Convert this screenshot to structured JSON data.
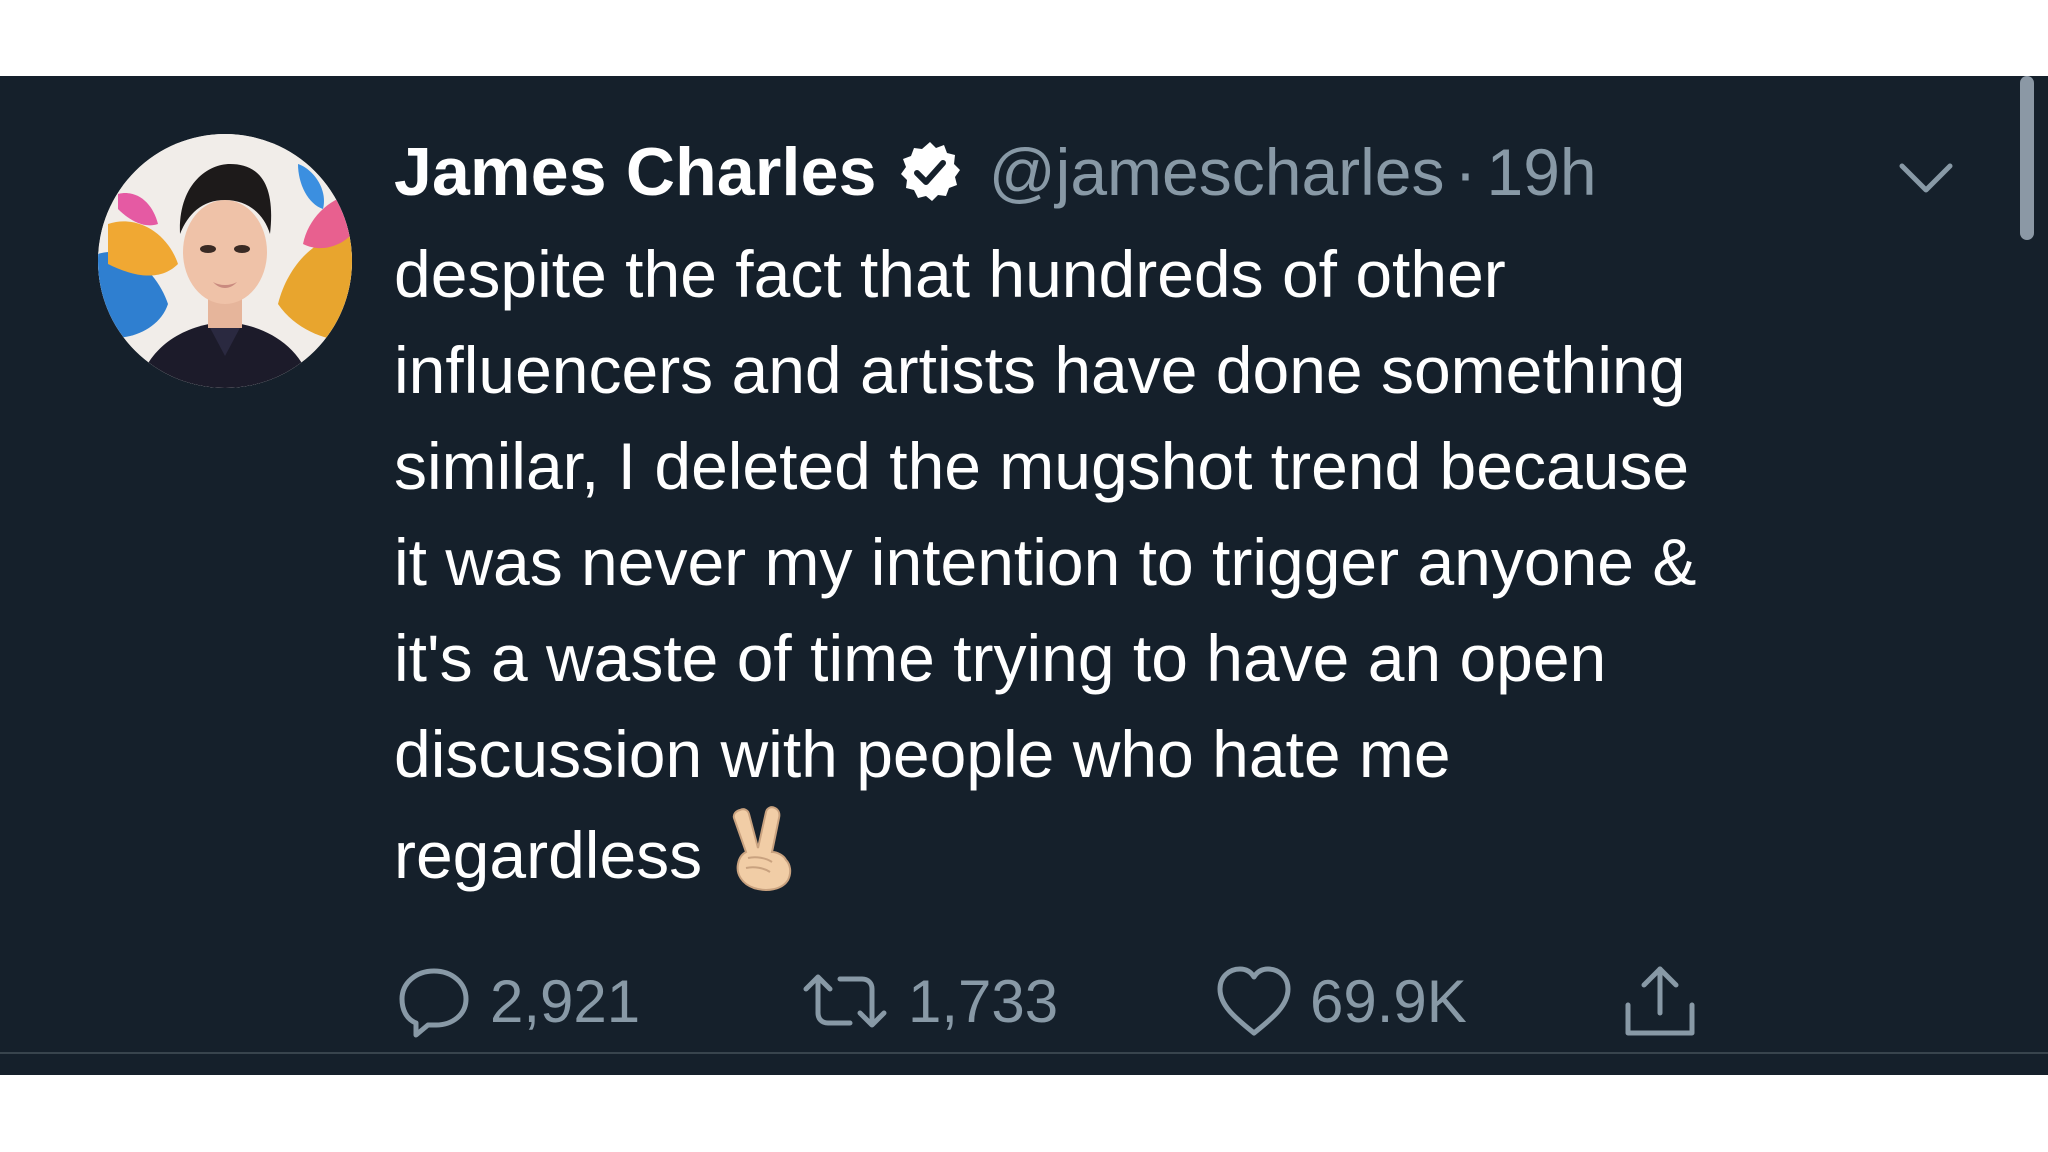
{
  "tweet": {
    "author": {
      "display_name": "James Charles",
      "handle": "@jamescharles",
      "verified": true
    },
    "separator": "·",
    "timestamp": "19h",
    "text_lines": [
      "despite the fact that hundreds of other",
      "influencers and artists have done something",
      "similar, I deleted the mugshot trend because",
      "it was never my intention to trigger anyone &",
      "it's a waste of time trying to have an open",
      "discussion with people who hate me",
      "regardless"
    ],
    "emoji": "victory-hand-icon",
    "actions": {
      "reply_count": "2,921",
      "retweet_count": "1,733",
      "like_count": "69.9K"
    }
  },
  "colors": {
    "background": "#15202b",
    "text_primary": "#ffffff",
    "text_secondary": "#8899a6",
    "divider": "#38444d"
  }
}
